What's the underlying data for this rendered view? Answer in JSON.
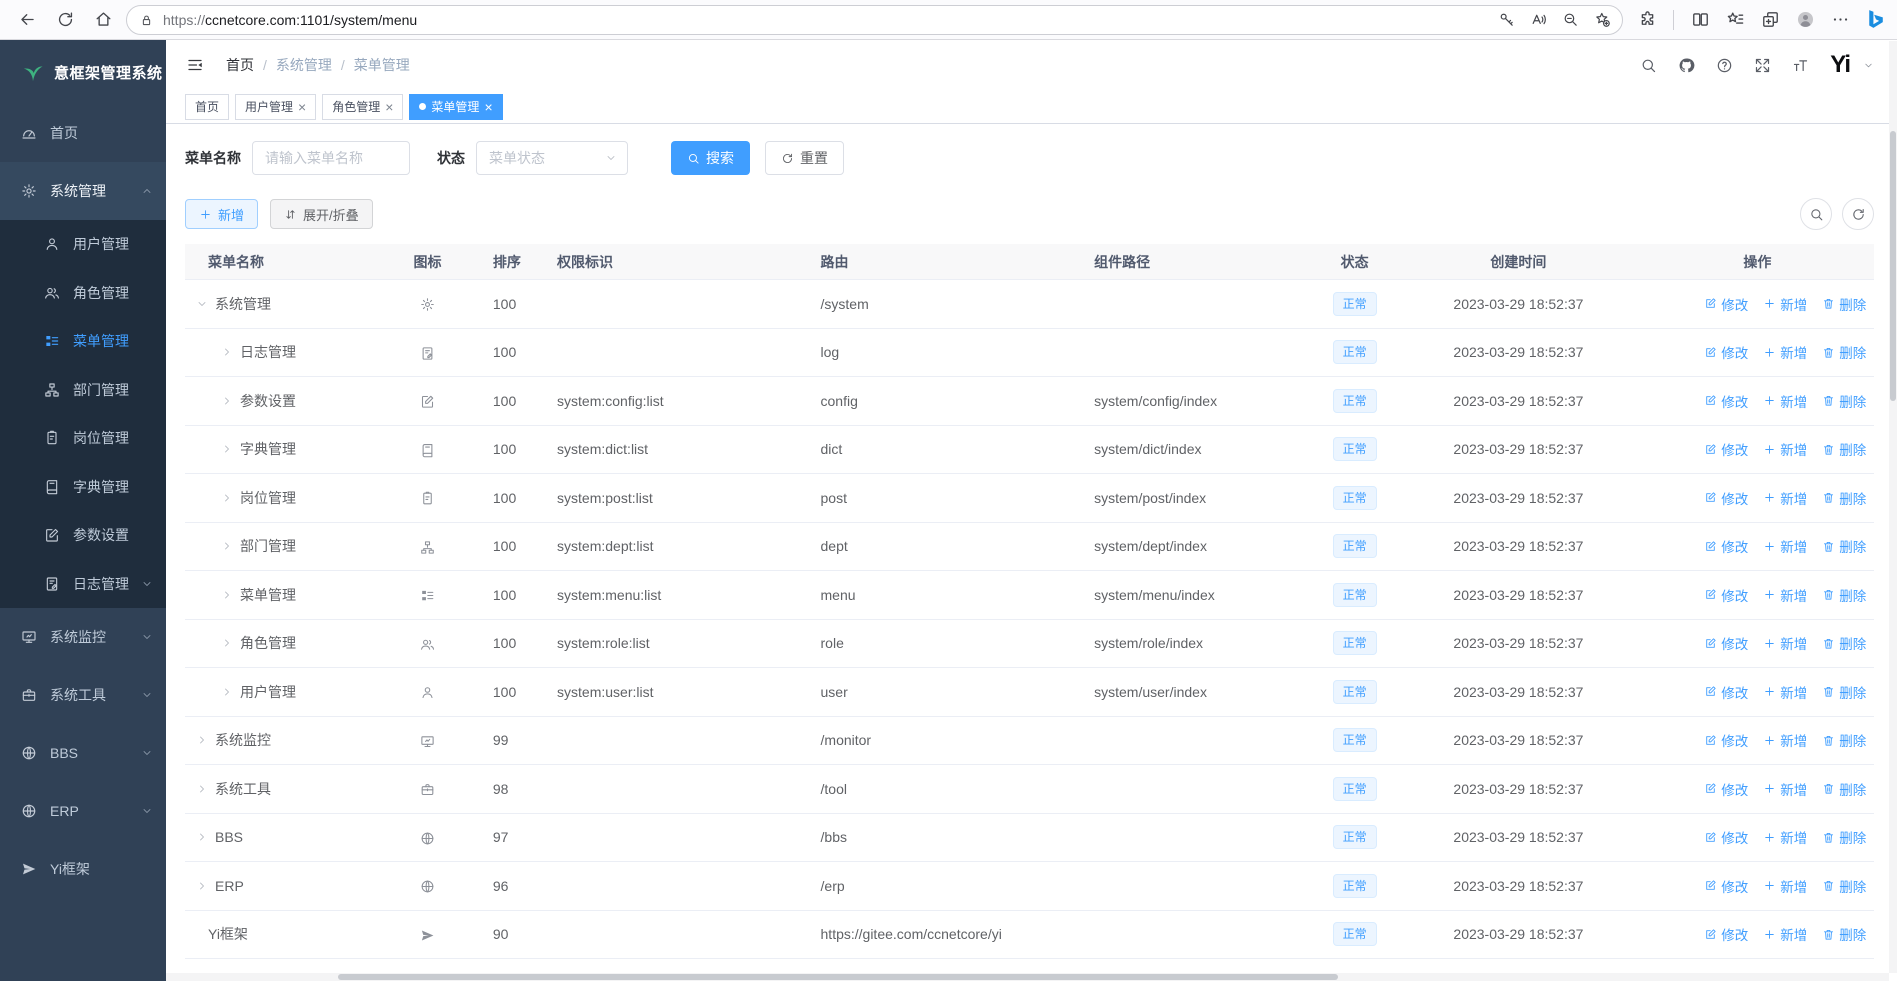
{
  "browser": {
    "url_scheme": "https://",
    "url_rest": "ccnetcore.com:1101/system/menu",
    "toolbar_left_icons": [
      "arrow-left",
      "refresh",
      "home"
    ],
    "urlbar_left_icon": "lock",
    "urlbar_right_icons": [
      "key",
      "read-aloud",
      "zoom-out",
      "star-plus"
    ],
    "toolbar_right_icons": [
      "extensions",
      "split-view",
      "favorites",
      "collections",
      "avatar",
      "dots",
      "bing"
    ]
  },
  "sidebar": {
    "logo": {
      "icon": "leaf",
      "title": "意框架管理系统"
    },
    "items": [
      {
        "label": "首页",
        "icon": "dashboard"
      },
      {
        "label": "系统管理",
        "icon": "gear",
        "expanded": true,
        "arrow": "up",
        "children": [
          {
            "label": "用户管理",
            "icon": "user"
          },
          {
            "label": "角色管理",
            "icon": "users"
          },
          {
            "label": "菜单管理",
            "icon": "menu",
            "active": true
          },
          {
            "label": "部门管理",
            "icon": "dept"
          },
          {
            "label": "岗位管理",
            "icon": "post"
          },
          {
            "label": "字典管理",
            "icon": "dict"
          },
          {
            "label": "参数设置",
            "icon": "edit"
          },
          {
            "label": "日志管理",
            "icon": "log",
            "arrow": "down"
          }
        ]
      },
      {
        "label": "系统监控",
        "icon": "monitor",
        "arrow": "down"
      },
      {
        "label": "系统工具",
        "icon": "tool",
        "arrow": "down"
      },
      {
        "label": "BBS",
        "icon": "globe",
        "arrow": "down"
      },
      {
        "label": "ERP",
        "icon": "globe",
        "arrow": "down"
      },
      {
        "label": "Yi框架",
        "icon": "plane"
      }
    ]
  },
  "header": {
    "breadcrumb": [
      "首页",
      "系统管理",
      "菜单管理"
    ],
    "action_icons": [
      "search",
      "github",
      "question",
      "fullscreen",
      "fontsize"
    ],
    "logo_text": "Yi"
  },
  "tabs": [
    {
      "label": "首页",
      "closable": false,
      "active": false
    },
    {
      "label": "用户管理",
      "closable": true,
      "active": false
    },
    {
      "label": "角色管理",
      "closable": true,
      "active": false
    },
    {
      "label": "菜单管理",
      "closable": true,
      "active": true
    }
  ],
  "filter": {
    "name_label": "菜单名称",
    "name_placeholder": "请输入菜单名称",
    "name_value": "",
    "status_label": "状态",
    "status_placeholder": "菜单状态",
    "search": "搜索",
    "reset": "重置"
  },
  "toolbar": {
    "add": "新增",
    "toggle": "展开/折叠",
    "mini_icons": [
      "search",
      "refresh"
    ]
  },
  "table": {
    "columns": [
      "菜单名称",
      "图标",
      "排序",
      "权限标识",
      "路由",
      "组件路径",
      "状态",
      "创建时间",
      "操作"
    ],
    "actions": [
      {
        "name": "edit",
        "icon": "edit-pen",
        "label": "修改"
      },
      {
        "name": "add",
        "icon": "plus",
        "label": "新增"
      },
      {
        "name": "delete",
        "icon": "trash",
        "label": "删除"
      }
    ],
    "rows": [
      {
        "name": "系统管理",
        "icon": "gear",
        "level": 0,
        "arrow": "down",
        "sort": "100",
        "perm": "",
        "route": "/system",
        "component": "",
        "status": "正常",
        "time": "2023-03-29 18:52:37"
      },
      {
        "name": "日志管理",
        "icon": "log",
        "level": 1,
        "arrow": "right",
        "sort": "100",
        "perm": "",
        "route": "log",
        "component": "",
        "status": "正常",
        "time": "2023-03-29 18:52:37"
      },
      {
        "name": "参数设置",
        "icon": "edit",
        "level": 1,
        "arrow": "right",
        "sort": "100",
        "perm": "system:config:list",
        "route": "config",
        "component": "system/config/index",
        "status": "正常",
        "time": "2023-03-29 18:52:37"
      },
      {
        "name": "字典管理",
        "icon": "dict",
        "level": 1,
        "arrow": "right",
        "sort": "100",
        "perm": "system:dict:list",
        "route": "dict",
        "component": "system/dict/index",
        "status": "正常",
        "time": "2023-03-29 18:52:37"
      },
      {
        "name": "岗位管理",
        "icon": "post",
        "level": 1,
        "arrow": "right",
        "sort": "100",
        "perm": "system:post:list",
        "route": "post",
        "component": "system/post/index",
        "status": "正常",
        "time": "2023-03-29 18:52:37"
      },
      {
        "name": "部门管理",
        "icon": "dept",
        "level": 1,
        "arrow": "right",
        "sort": "100",
        "perm": "system:dept:list",
        "route": "dept",
        "component": "system/dept/index",
        "status": "正常",
        "time": "2023-03-29 18:52:37"
      },
      {
        "name": "菜单管理",
        "icon": "menu",
        "level": 1,
        "arrow": "right",
        "sort": "100",
        "perm": "system:menu:list",
        "route": "menu",
        "component": "system/menu/index",
        "status": "正常",
        "time": "2023-03-29 18:52:37"
      },
      {
        "name": "角色管理",
        "icon": "users",
        "level": 1,
        "arrow": "right",
        "sort": "100",
        "perm": "system:role:list",
        "route": "role",
        "component": "system/role/index",
        "status": "正常",
        "time": "2023-03-29 18:52:37"
      },
      {
        "name": "用户管理",
        "icon": "user",
        "level": 1,
        "arrow": "right",
        "sort": "100",
        "perm": "system:user:list",
        "route": "user",
        "component": "system/user/index",
        "status": "正常",
        "time": "2023-03-29 18:52:37"
      },
      {
        "name": "系统监控",
        "icon": "monitor",
        "level": 0,
        "arrow": "right",
        "sort": "99",
        "perm": "",
        "route": "/monitor",
        "component": "",
        "status": "正常",
        "time": "2023-03-29 18:52:37"
      },
      {
        "name": "系统工具",
        "icon": "tool",
        "level": 0,
        "arrow": "right",
        "sort": "98",
        "perm": "",
        "route": "/tool",
        "component": "",
        "status": "正常",
        "time": "2023-03-29 18:52:37"
      },
      {
        "name": "BBS",
        "icon": "globe",
        "level": 0,
        "arrow": "right",
        "sort": "97",
        "perm": "",
        "route": "/bbs",
        "component": "",
        "status": "正常",
        "time": "2023-03-29 18:52:37"
      },
      {
        "name": "ERP",
        "icon": "globe",
        "level": 0,
        "arrow": "right",
        "sort": "96",
        "perm": "",
        "route": "/erp",
        "component": "",
        "status": "正常",
        "time": "2023-03-29 18:52:37"
      },
      {
        "name": "Yi框架",
        "icon": "plane",
        "level": 0,
        "arrow": "",
        "sort": "90",
        "perm": "",
        "route": "https://gitee.com/ccnetcore/yi",
        "component": "",
        "status": "正常",
        "time": "2023-03-29 18:52:37"
      }
    ]
  },
  "colors": {
    "primary": "#409eff",
    "sidebar_bg": "#304156",
    "submenu_bg": "#1f2d3d",
    "status_bg": "#ecf5ff",
    "status_border": "#d9ecff",
    "logo_green": "#3eb380"
  }
}
